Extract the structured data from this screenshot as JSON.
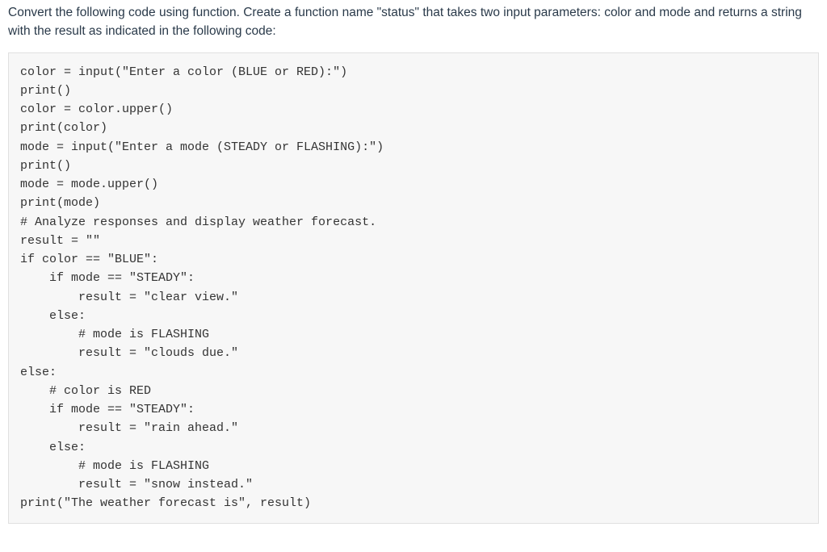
{
  "instructions": "Convert the following code using function. Create a function name \"status\" that takes two input parameters: color and mode and returns a string with the result as indicated in the following code:",
  "code_lines": [
    "color = input(\"Enter a color (BLUE or RED):\")",
    "print()",
    "color = color.upper()",
    "print(color)",
    "mode = input(\"Enter a mode (STEADY or FLASHING):\")",
    "print()",
    "mode = mode.upper()",
    "print(mode)",
    "# Analyze responses and display weather forecast.",
    "result = \"\"",
    "if color == \"BLUE\":",
    "    if mode == \"STEADY\":",
    "        result = \"clear view.\"",
    "    else:",
    "        # mode is FLASHING",
    "        result = \"clouds due.\"",
    "else:",
    "    # color is RED",
    "    if mode == \"STEADY\":",
    "        result = \"rain ahead.\"",
    "    else:",
    "        # mode is FLASHING",
    "        result = \"snow instead.\"",
    "",
    "print(\"The weather forecast is\", result)"
  ]
}
